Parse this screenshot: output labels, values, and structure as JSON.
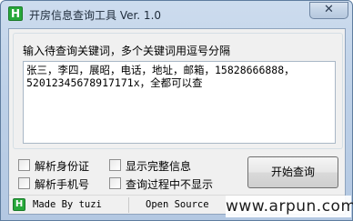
{
  "window": {
    "title": "开房信息查询工具 Ver. 1.0",
    "icon_glyph": "H",
    "close_glyph": "✕"
  },
  "search": {
    "prompt": "输入待查询关键词，多个关键词用逗号分隔",
    "keywords_value": "张三，李四，展昭，电话，地址，邮箱，15828666888，\n52012345678917171x，全都可以查"
  },
  "options": {
    "parse_id": "解析身份证",
    "show_full": "显示完整信息",
    "parse_phone": "解析手机号",
    "hide_process": "查询过程中不显示"
  },
  "actions": {
    "start_label": "开始查询"
  },
  "status": {
    "icon_glyph": "H",
    "author": "Made By tuzi",
    "source": "Open Source"
  },
  "watermark": {
    "text": "www.arpun.com"
  },
  "colors": {
    "icon_green": "#27a83a",
    "frame_blue": "#bed1e8"
  }
}
